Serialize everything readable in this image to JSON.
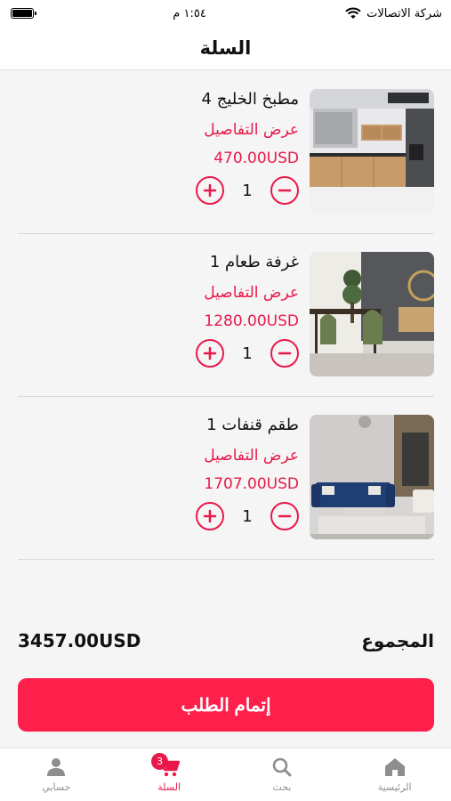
{
  "status_bar": {
    "carrier": "شركة الاتصالات",
    "time": "١:٥٤ م"
  },
  "header": {
    "title": "السلة"
  },
  "cart": {
    "items": [
      {
        "name": "مطبخ الخليج 4",
        "details_label": "عرض التفاصيل",
        "price": "470.00USD",
        "quantity": "1",
        "image_icon": "kitchen-photo"
      },
      {
        "name": "غرفة طعام 1",
        "details_label": "عرض التفاصيل",
        "price": "1280.00USD",
        "quantity": "1",
        "image_icon": "dining-room-photo"
      },
      {
        "name": "طقم قنفات 1",
        "details_label": "عرض التفاصيل",
        "price": "1707.00USD",
        "quantity": "1",
        "image_icon": "sofa-set-photo"
      }
    ]
  },
  "summary": {
    "total_label": "المجموع",
    "total_value": "3457.00USD",
    "checkout_label": "إتمام الطلب"
  },
  "tab_bar": {
    "tabs": [
      {
        "label": "الرئيسية",
        "icon": "home-icon"
      },
      {
        "label": "بحث",
        "icon": "search-icon"
      },
      {
        "label": "السلة",
        "icon": "cart-icon",
        "badge": "3",
        "active": true
      },
      {
        "label": "حسابي",
        "icon": "user-icon"
      }
    ]
  },
  "colors": {
    "accent": "#e8194a",
    "checkout": "#ff1f4b",
    "inactive_tab": "#8e8e8e"
  }
}
